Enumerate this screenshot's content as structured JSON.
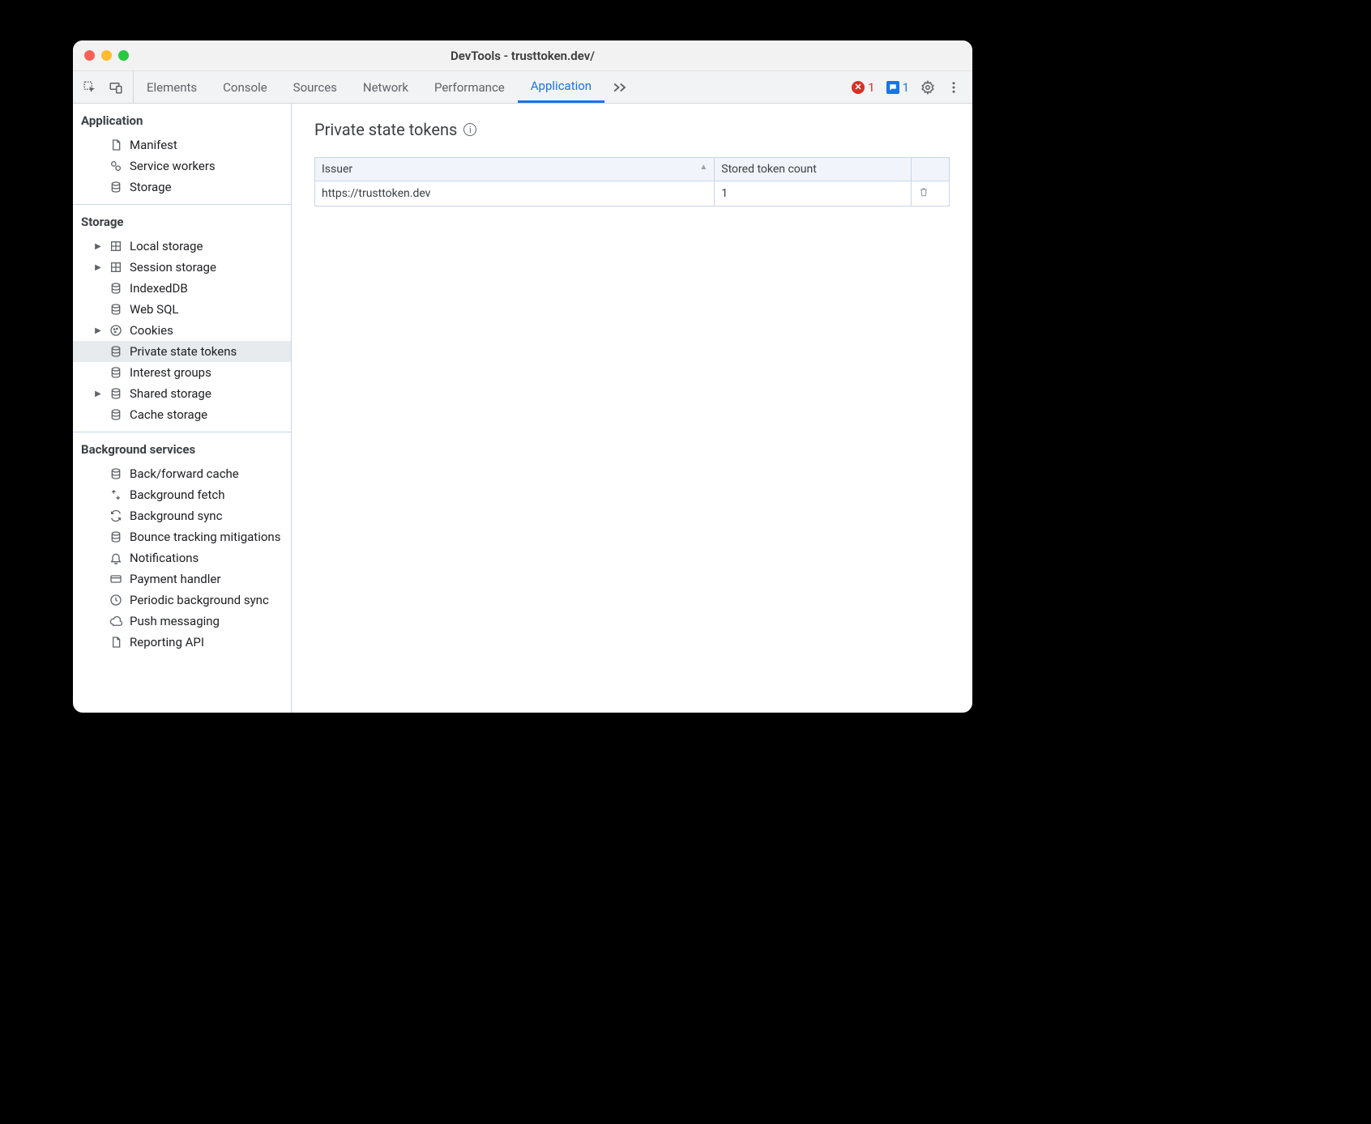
{
  "window": {
    "title": "DevTools - trusttoken.dev/"
  },
  "toolbar": {
    "tabs": [
      "Elements",
      "Console",
      "Sources",
      "Network",
      "Performance",
      "Application"
    ],
    "active_tab": "Application",
    "errors": "1",
    "messages": "1"
  },
  "sidebar": {
    "sections": {
      "application": {
        "title": "Application",
        "items": [
          {
            "label": "Manifest",
            "icon": "file-icon"
          },
          {
            "label": "Service workers",
            "icon": "gears-icon"
          },
          {
            "label": "Storage",
            "icon": "database-icon"
          }
        ]
      },
      "storage": {
        "title": "Storage",
        "items": [
          {
            "label": "Local storage",
            "icon": "table-icon",
            "expandable": true
          },
          {
            "label": "Session storage",
            "icon": "table-icon",
            "expandable": true
          },
          {
            "label": "IndexedDB",
            "icon": "database-icon"
          },
          {
            "label": "Web SQL",
            "icon": "database-icon"
          },
          {
            "label": "Cookies",
            "icon": "cookie-icon",
            "expandable": true
          },
          {
            "label": "Private state tokens",
            "icon": "database-icon",
            "selected": true
          },
          {
            "label": "Interest groups",
            "icon": "database-icon"
          },
          {
            "label": "Shared storage",
            "icon": "database-icon",
            "expandable": true
          },
          {
            "label": "Cache storage",
            "icon": "database-icon"
          }
        ]
      },
      "background": {
        "title": "Background services",
        "items": [
          {
            "label": "Back/forward cache",
            "icon": "database-icon"
          },
          {
            "label": "Background fetch",
            "icon": "fetch-icon"
          },
          {
            "label": "Background sync",
            "icon": "sync-icon"
          },
          {
            "label": "Bounce tracking mitigations",
            "icon": "database-icon"
          },
          {
            "label": "Notifications",
            "icon": "bell-icon"
          },
          {
            "label": "Payment handler",
            "icon": "card-icon"
          },
          {
            "label": "Periodic background sync",
            "icon": "clock-icon"
          },
          {
            "label": "Push messaging",
            "icon": "cloud-icon"
          },
          {
            "label": "Reporting API",
            "icon": "file-icon"
          }
        ]
      }
    }
  },
  "main": {
    "title": "Private state tokens",
    "table": {
      "headers": {
        "issuer": "Issuer",
        "count": "Stored token count"
      },
      "rows": [
        {
          "issuer": "https://trusttoken.dev",
          "count": "1"
        }
      ]
    }
  }
}
